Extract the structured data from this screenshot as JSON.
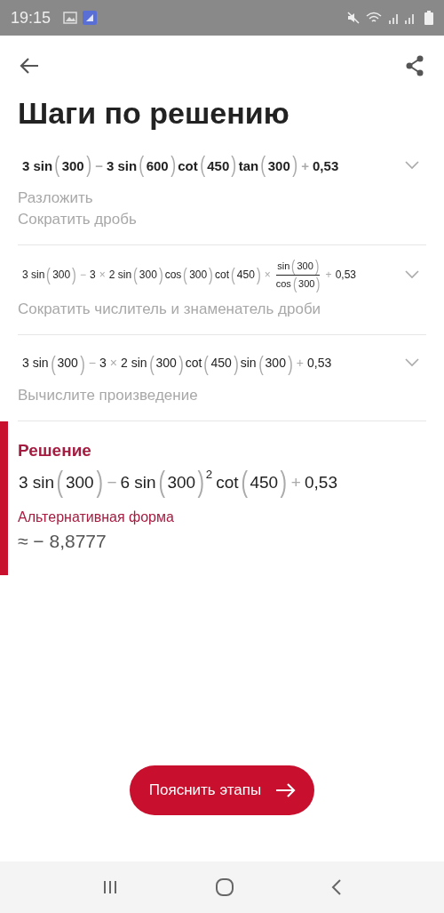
{
  "status_bar": {
    "time": "19:15"
  },
  "header": {
    "title": "Шаги по решению"
  },
  "steps": [
    {
      "emphasized": true,
      "expanded": false,
      "expression": [
        {
          "kind": "text",
          "text": "3 sin"
        },
        {
          "kind": "paren",
          "text": "("
        },
        {
          "kind": "text",
          "text": "300"
        },
        {
          "kind": "paren",
          "text": ")"
        },
        {
          "kind": "op",
          "text": "−"
        },
        {
          "kind": "text",
          "text": "3 sin"
        },
        {
          "kind": "paren",
          "text": "("
        },
        {
          "kind": "text",
          "text": "600"
        },
        {
          "kind": "paren",
          "text": ")"
        },
        {
          "kind": "text",
          "text": "cot"
        },
        {
          "kind": "paren",
          "text": "("
        },
        {
          "kind": "text",
          "text": "450"
        },
        {
          "kind": "paren",
          "text": ")"
        },
        {
          "kind": "text",
          "text": "tan"
        },
        {
          "kind": "paren",
          "text": "("
        },
        {
          "kind": "text",
          "text": "300"
        },
        {
          "kind": "paren",
          "text": ")"
        },
        {
          "kind": "op",
          "text": "+"
        },
        {
          "kind": "text",
          "text": "0,53"
        }
      ],
      "hints": [
        "Разложить",
        "Сократить дробь"
      ]
    },
    {
      "emphasized": false,
      "expanded": false,
      "expression": [
        {
          "kind": "text",
          "text": "3 sin"
        },
        {
          "kind": "paren",
          "text": "("
        },
        {
          "kind": "text",
          "text": "300"
        },
        {
          "kind": "paren",
          "text": ")"
        },
        {
          "kind": "op",
          "text": "−"
        },
        {
          "kind": "text",
          "text": "3"
        },
        {
          "kind": "op",
          "text": "×"
        },
        {
          "kind": "text",
          "text": "2 sin"
        },
        {
          "kind": "paren",
          "text": "("
        },
        {
          "kind": "text",
          "text": "300"
        },
        {
          "kind": "paren",
          "text": ")"
        },
        {
          "kind": "text",
          "text": "cos"
        },
        {
          "kind": "paren",
          "text": "("
        },
        {
          "kind": "text",
          "text": "300"
        },
        {
          "kind": "paren",
          "text": ")"
        },
        {
          "kind": "text",
          "text": "cot"
        },
        {
          "kind": "paren",
          "text": "("
        },
        {
          "kind": "text",
          "text": "450"
        },
        {
          "kind": "paren",
          "text": ")"
        },
        {
          "kind": "op",
          "text": "×"
        },
        {
          "kind": "frac",
          "num": [
            {
              "kind": "text",
              "text": "sin"
            },
            {
              "kind": "paren",
              "text": "("
            },
            {
              "kind": "text",
              "text": "300"
            },
            {
              "kind": "paren",
              "text": ")"
            }
          ],
          "den": [
            {
              "kind": "text",
              "text": "cos"
            },
            {
              "kind": "paren",
              "text": "("
            },
            {
              "kind": "text",
              "text": "300"
            },
            {
              "kind": "paren",
              "text": ")"
            }
          ]
        },
        {
          "kind": "op",
          "text": "+"
        },
        {
          "kind": "text",
          "text": "0,53"
        }
      ],
      "hints": [
        "Сократить числитель и знаменатель дроби"
      ]
    },
    {
      "emphasized": false,
      "expanded": false,
      "expression": [
        {
          "kind": "text",
          "text": "3 sin"
        },
        {
          "kind": "paren",
          "text": "("
        },
        {
          "kind": "text",
          "text": "300"
        },
        {
          "kind": "paren",
          "text": ")"
        },
        {
          "kind": "op",
          "text": "−"
        },
        {
          "kind": "text",
          "text": "3"
        },
        {
          "kind": "op",
          "text": "×"
        },
        {
          "kind": "text",
          "text": "2 sin"
        },
        {
          "kind": "paren",
          "text": "("
        },
        {
          "kind": "text",
          "text": "300"
        },
        {
          "kind": "paren",
          "text": ")"
        },
        {
          "kind": "text",
          "text": "cot"
        },
        {
          "kind": "paren",
          "text": "("
        },
        {
          "kind": "text",
          "text": "450"
        },
        {
          "kind": "paren",
          "text": ")"
        },
        {
          "kind": "text",
          "text": "sin"
        },
        {
          "kind": "paren",
          "text": "("
        },
        {
          "kind": "text",
          "text": "300"
        },
        {
          "kind": "paren",
          "text": ")"
        },
        {
          "kind": "op",
          "text": "+"
        },
        {
          "kind": "text",
          "text": "0,53"
        }
      ],
      "hints": [
        "Вычислите произведение"
      ]
    }
  ],
  "solution": {
    "title": "Решение",
    "expression": [
      {
        "kind": "text",
        "text": "3 sin"
      },
      {
        "kind": "paren",
        "text": "("
      },
      {
        "kind": "text",
        "text": "300"
      },
      {
        "kind": "paren",
        "text": ")"
      },
      {
        "kind": "op",
        "text": "−"
      },
      {
        "kind": "text",
        "text": "6 sin"
      },
      {
        "kind": "paren",
        "text": "("
      },
      {
        "kind": "text",
        "text": "300"
      },
      {
        "kind": "paren",
        "text": ")"
      },
      {
        "kind": "sup",
        "text": "2"
      },
      {
        "kind": "text",
        "text": "cot"
      },
      {
        "kind": "paren",
        "text": "("
      },
      {
        "kind": "text",
        "text": "450"
      },
      {
        "kind": "paren",
        "text": ")"
      },
      {
        "kind": "op",
        "text": "+"
      },
      {
        "kind": "text",
        "text": "0,53"
      }
    ],
    "alternative_label": "Альтернативная форма",
    "alternative_value": "≈ − 8,8777"
  },
  "button": {
    "label": "Пояснить этапы"
  }
}
